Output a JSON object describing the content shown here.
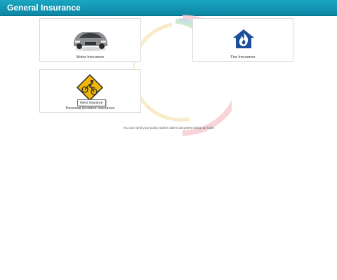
{
  "header": {
    "title": "General Insurance"
  },
  "cards": [
    {
      "label": "Motor Insurance",
      "icon": "car-icon"
    },
    {
      "label": "Fire Insurance",
      "icon": "house-fire-icon"
    },
    {
      "label": "Personal Accident Insurance",
      "icon": "accident-warning-icon"
    }
  ],
  "tooltip": {
    "text": "Motor Insurance"
  },
  "footer": {
    "note": "You can send your policy and/or claims document using our tools"
  },
  "colors": {
    "header": "#0b86a4",
    "fire_icon": "#1b4f9c",
    "warning_sign": "#f2b705"
  }
}
